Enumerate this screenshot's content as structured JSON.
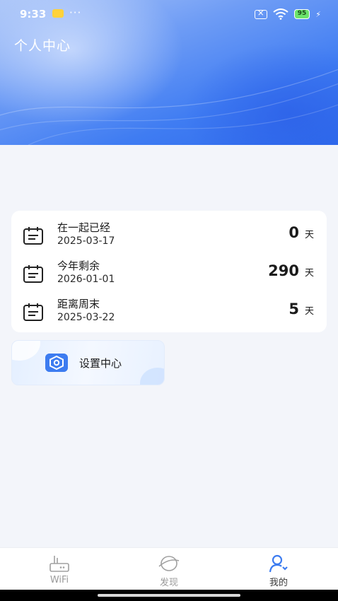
{
  "status_bar": {
    "time": "9:33",
    "dots": "···",
    "battery": "95"
  },
  "header": {
    "title": "个人中心"
  },
  "day_counters": [
    {
      "title": "在一起已经",
      "date": "2025-03-17",
      "value": "0",
      "unit": "天"
    },
    {
      "title": "今年剩余",
      "date": "2026-01-01",
      "value": "290",
      "unit": "天"
    },
    {
      "title": "距离周末",
      "date": "2025-03-22",
      "value": "5",
      "unit": "天"
    }
  ],
  "settings": {
    "label": "设置中心"
  },
  "tabbar": {
    "tabs": [
      {
        "label": "WiFi",
        "active": false
      },
      {
        "label": "发现",
        "active": false
      },
      {
        "label": "我的",
        "active": true
      }
    ]
  },
  "colors": {
    "accent": "#3d7cf0",
    "tab_inactive": "#9a9a9a",
    "tab_active": "#3d7cf0"
  }
}
